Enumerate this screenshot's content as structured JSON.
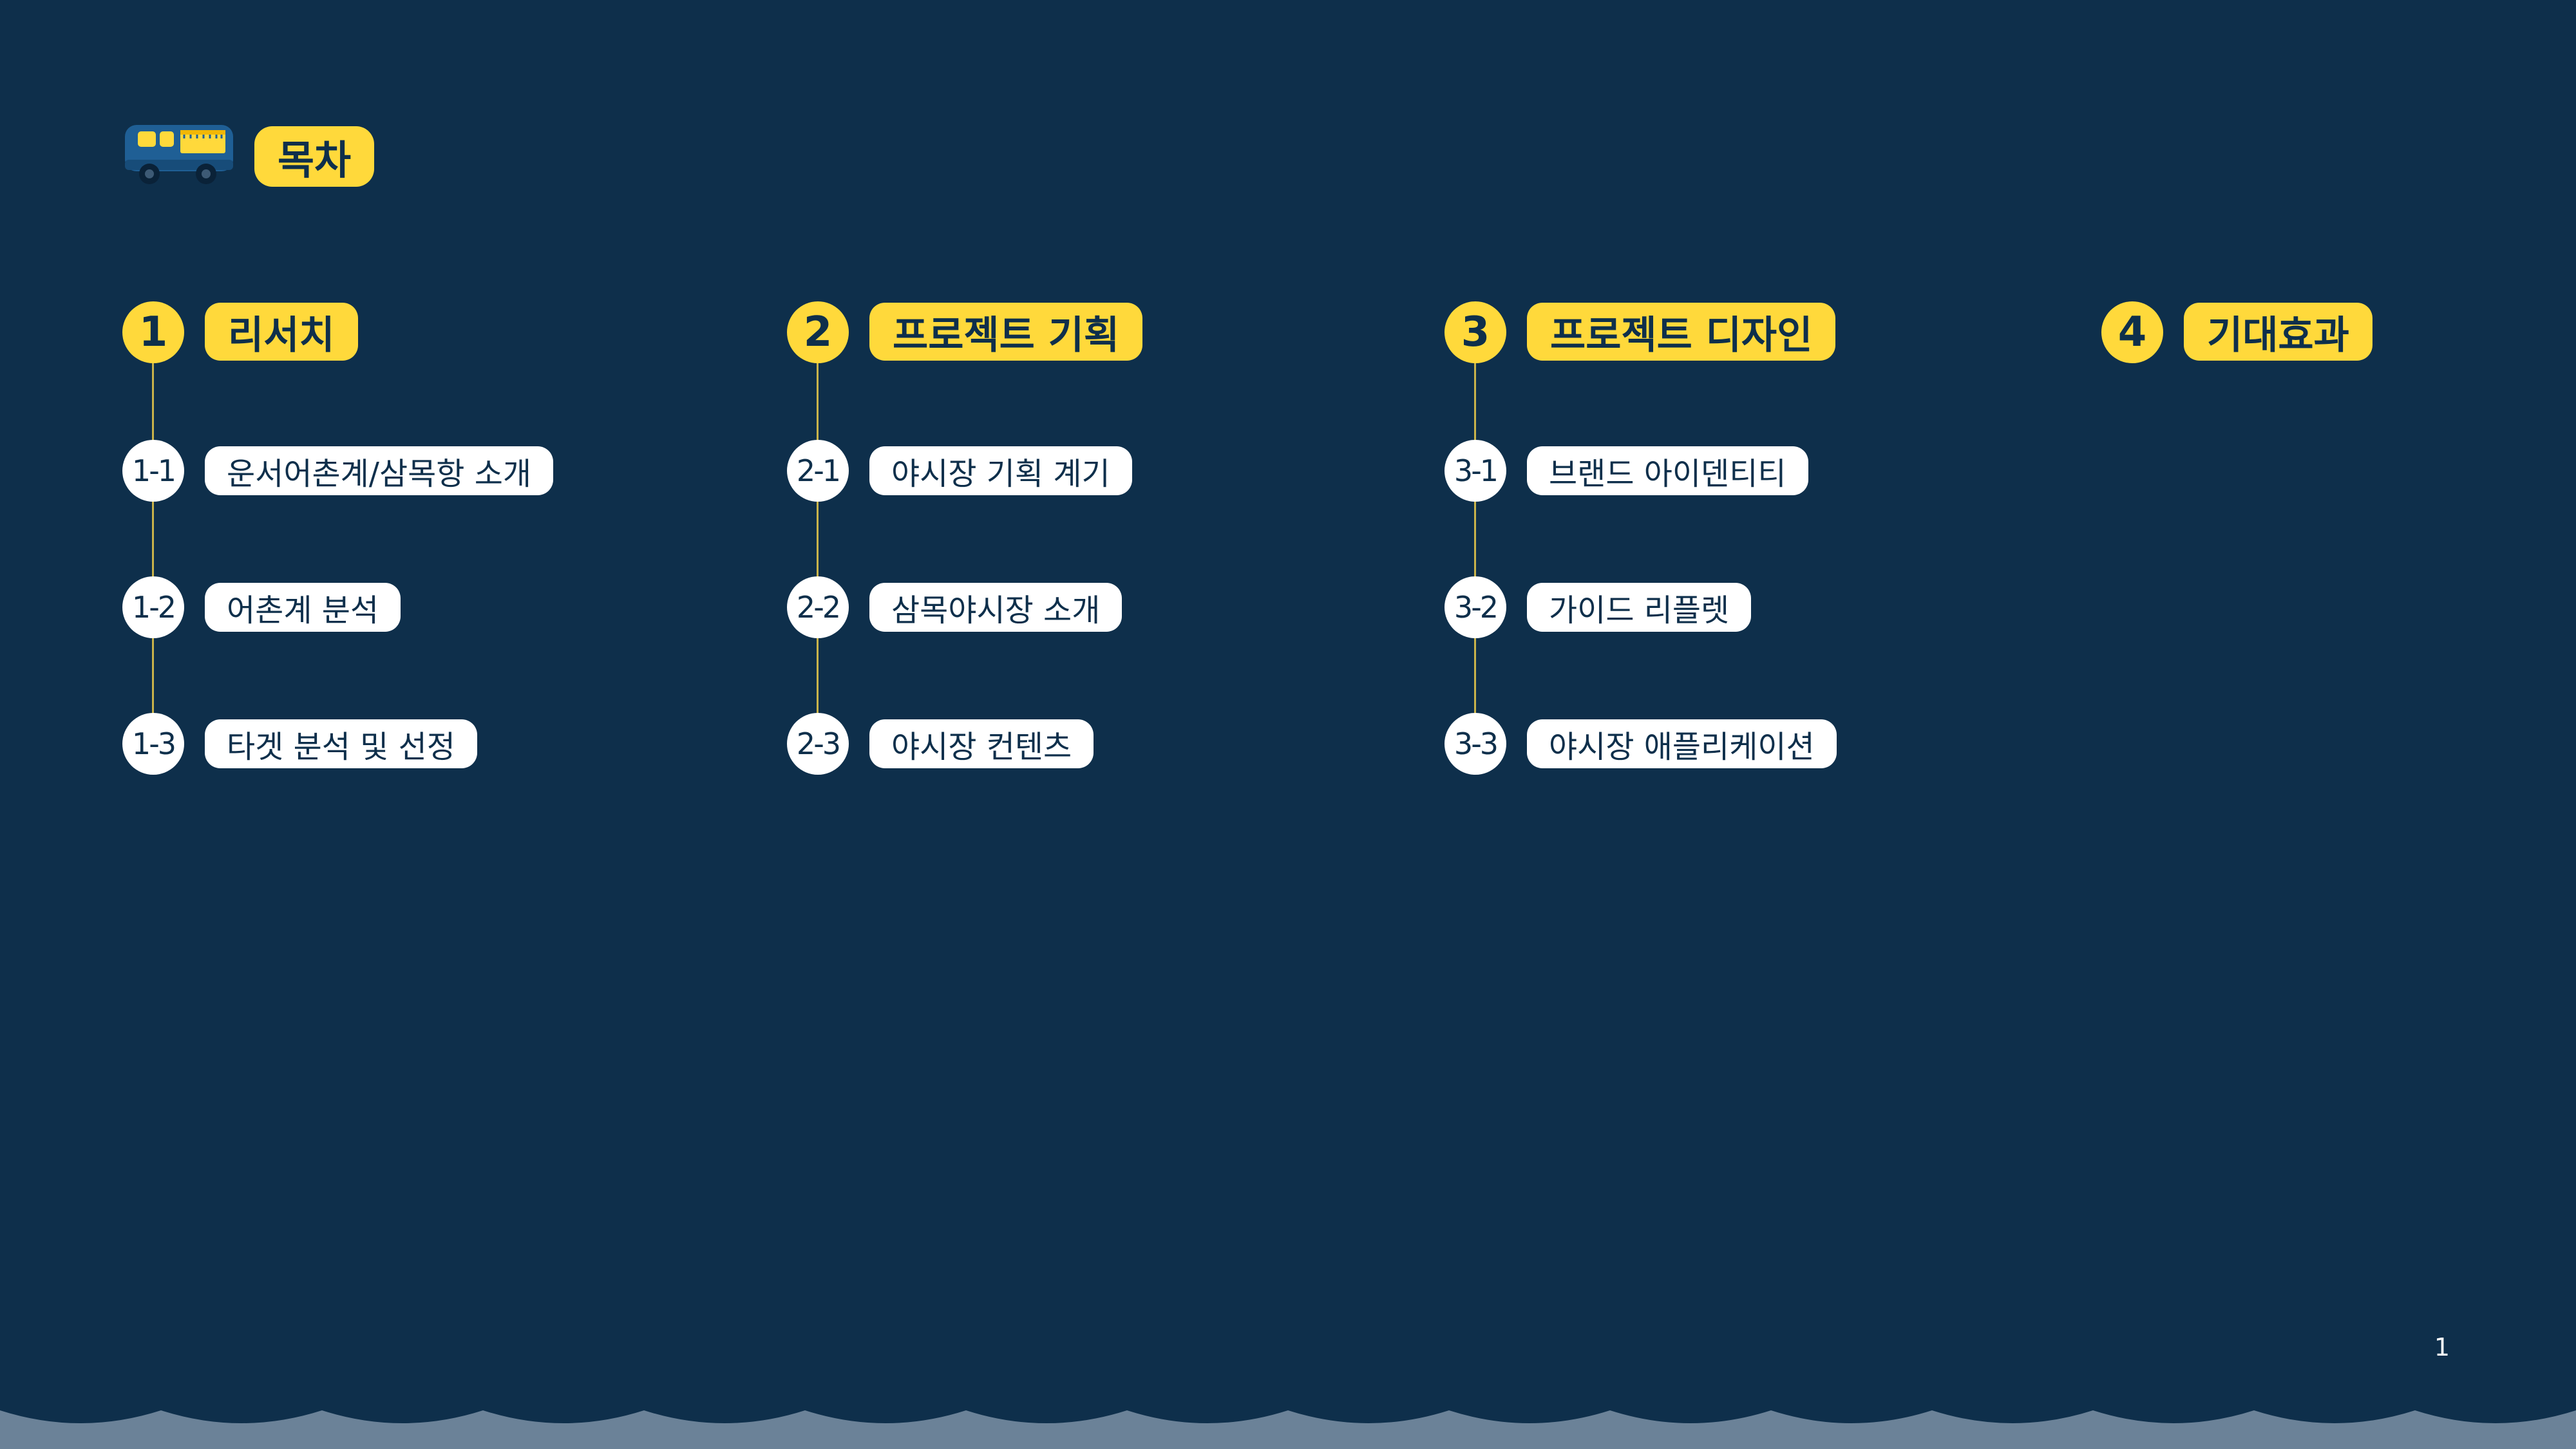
{
  "header": {
    "title": "목차",
    "icon": "food-truck-icon"
  },
  "colors": {
    "background": "#0e2f4b",
    "accent": "#ffd93b",
    "pill_white": "#ffffff",
    "connector": "#c9b34a",
    "footer_wave": "#6b8298"
  },
  "sections": [
    {
      "number": "1",
      "title": "리서치",
      "items": [
        {
          "num": "1-1",
          "label": "운서어촌계/삼목항 소개"
        },
        {
          "num": "1-2",
          "label": "어촌계 분석"
        },
        {
          "num": "1-3",
          "label": "타겟 분석 및 선정"
        }
      ]
    },
    {
      "number": "2",
      "title": "프로젝트 기획",
      "items": [
        {
          "num": "2-1",
          "label": "야시장 기획 계기"
        },
        {
          "num": "2-2",
          "label": "삼목야시장 소개"
        },
        {
          "num": "2-3",
          "label": "야시장 컨텐츠"
        }
      ]
    },
    {
      "number": "3",
      "title": "프로젝트 디자인",
      "items": [
        {
          "num": "3-1",
          "label": "브랜드 아이덴티티"
        },
        {
          "num": "3-2",
          "label": "가이드 리플렛"
        },
        {
          "num": "3-3",
          "label": "야시장 애플리케이션"
        }
      ]
    },
    {
      "number": "4",
      "title": "기대효과",
      "items": []
    }
  ],
  "page_number": "1"
}
